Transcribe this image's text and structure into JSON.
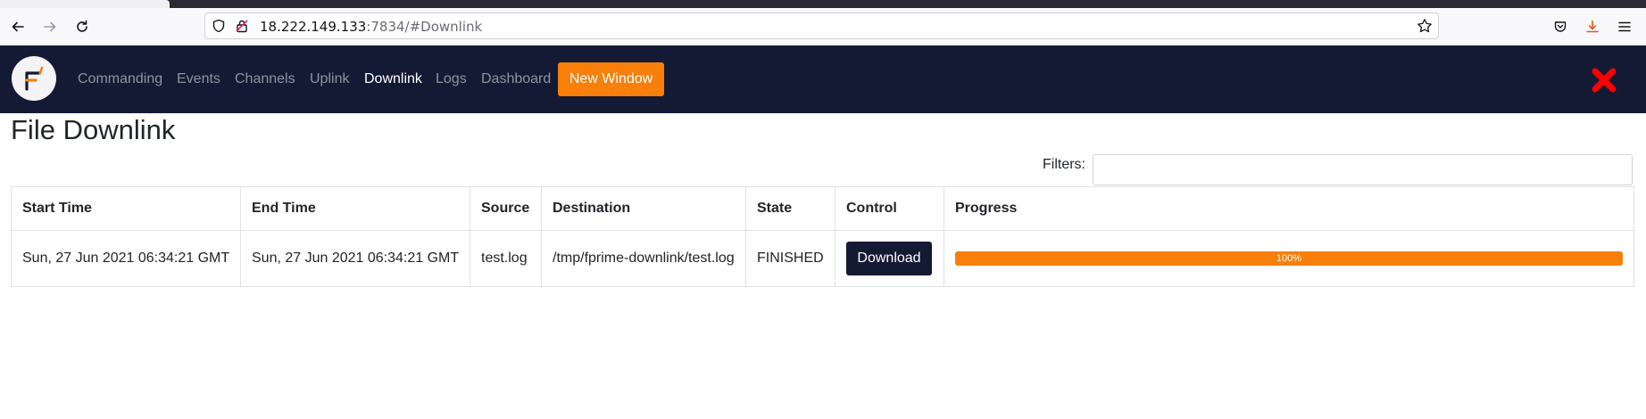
{
  "browser": {
    "url_host": "18.222.149.133",
    "url_path": ":7834/#Downlink"
  },
  "nav": {
    "items": [
      {
        "label": "Commanding",
        "active": false
      },
      {
        "label": "Events",
        "active": false
      },
      {
        "label": "Channels",
        "active": false
      },
      {
        "label": "Uplink",
        "active": false
      },
      {
        "label": "Downlink",
        "active": true
      },
      {
        "label": "Logs",
        "active": false
      },
      {
        "label": "Dashboard",
        "active": false
      }
    ],
    "new_window_label": "New Window",
    "status_icon": "red-x-icon"
  },
  "page": {
    "title": "File Downlink",
    "filter_label": "Filters:",
    "filter_value": ""
  },
  "table": {
    "headers": [
      "Start Time",
      "End Time",
      "Source",
      "Destination",
      "State",
      "Control",
      "Progress"
    ],
    "rows": [
      {
        "start_time": "Sun, 27 Jun 2021 06:34:21 GMT",
        "end_time": "Sun, 27 Jun 2021 06:34:21 GMT",
        "source": "test.log",
        "destination": "/tmp/fprime-downlink/test.log",
        "state": "FINISHED",
        "control_label": "Download",
        "progress_label": "100%",
        "progress_fraction": 1.0
      }
    ]
  },
  "colors": {
    "nav_bg": "#141a33",
    "accent": "#f77f0a",
    "status_x": "#ff0000"
  }
}
